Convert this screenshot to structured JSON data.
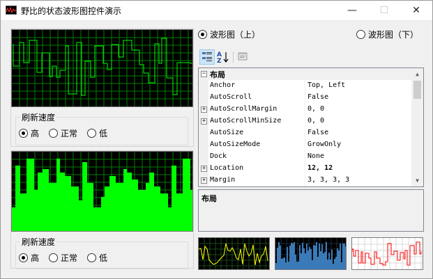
{
  "window": {
    "title": "野比的状态波形图控件演示",
    "minimize_glyph": "—",
    "maximize_glyph": "☐",
    "close_glyph": "✕"
  },
  "colors": {
    "scope_bg": "#000000",
    "grid": "#008000",
    "trace_green": "#00ff00",
    "trace_yellow": "#ffff00",
    "trace_blue": "#3a7ab8",
    "trace_red": "#ff0000"
  },
  "top_refresh": {
    "legend": "刷新速度",
    "options": [
      "高",
      "正常",
      "低"
    ],
    "selected": 0
  },
  "bottom_refresh": {
    "legend": "刷新速度",
    "options": [
      "高",
      "正常",
      "低"
    ],
    "selected": 0
  },
  "chart_select": {
    "upper_label": "波形图（上）",
    "lower_label": "波形图（下）",
    "selected": "upper"
  },
  "toolbar": {
    "categorized_icon": "categorized-icon",
    "alphabetical_icon": "alphabetical-sort-icon",
    "property_pages_icon": "property-pages-icon"
  },
  "property_grid": {
    "category": "布局",
    "rows": [
      {
        "name": "Anchor",
        "value": "Top, Left",
        "expandable": false,
        "bold": false
      },
      {
        "name": "AutoScroll",
        "value": "False",
        "expandable": false,
        "bold": false
      },
      {
        "name": "AutoScrollMargin",
        "value": "0, 0",
        "expandable": true,
        "bold": false
      },
      {
        "name": "AutoScrollMinSize",
        "value": "0, 0",
        "expandable": true,
        "bold": false
      },
      {
        "name": "AutoSize",
        "value": "False",
        "expandable": false,
        "bold": false
      },
      {
        "name": "AutoSizeMode",
        "value": "GrowOnly",
        "expandable": false,
        "bold": false
      },
      {
        "name": "Dock",
        "value": "None",
        "expandable": false,
        "bold": false
      },
      {
        "name": "Location",
        "value": "12, 12",
        "expandable": true,
        "bold": true
      },
      {
        "name": "Margin",
        "value": "3, 3, 3, 3",
        "expandable": true,
        "bold": false
      }
    ],
    "help_title": "布局"
  }
}
